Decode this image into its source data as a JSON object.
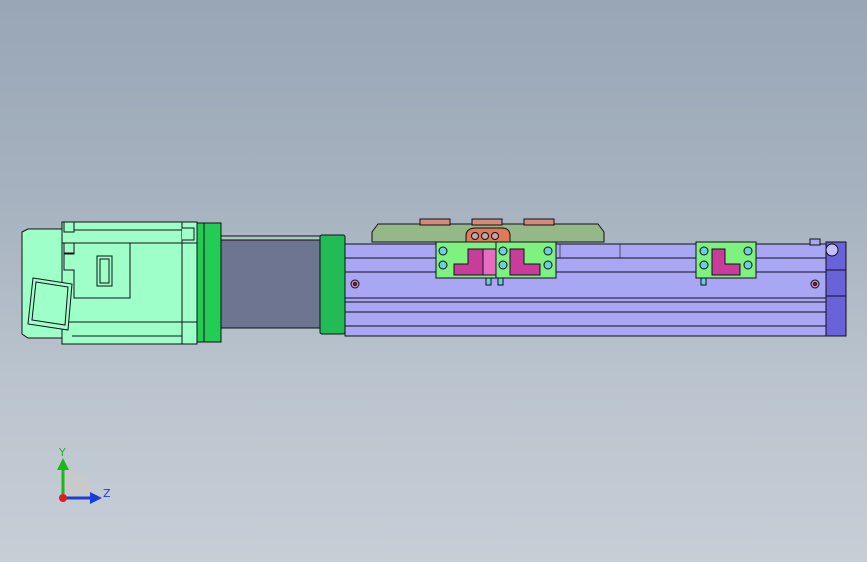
{
  "triad": {
    "y_label": "Y",
    "z_label": "Z",
    "colors": {
      "y": "#1fb51f",
      "z": "#1a3fd8",
      "x": "#d82020"
    }
  },
  "colors": {
    "background_top": "#98a6b6",
    "background_bottom": "#c6ced6",
    "motor": "#9effc8",
    "motor_flange": "#22cc55",
    "coupling_housing": "#6e7590",
    "rail": "#a9a6f4",
    "rail_end": "#6a62d8",
    "carriage_plate": "#95b889",
    "slider_block": "#7ef27e",
    "slider_pink": "#c83c9c",
    "cable_clamp": "#e0785a",
    "outline": "#101018"
  }
}
